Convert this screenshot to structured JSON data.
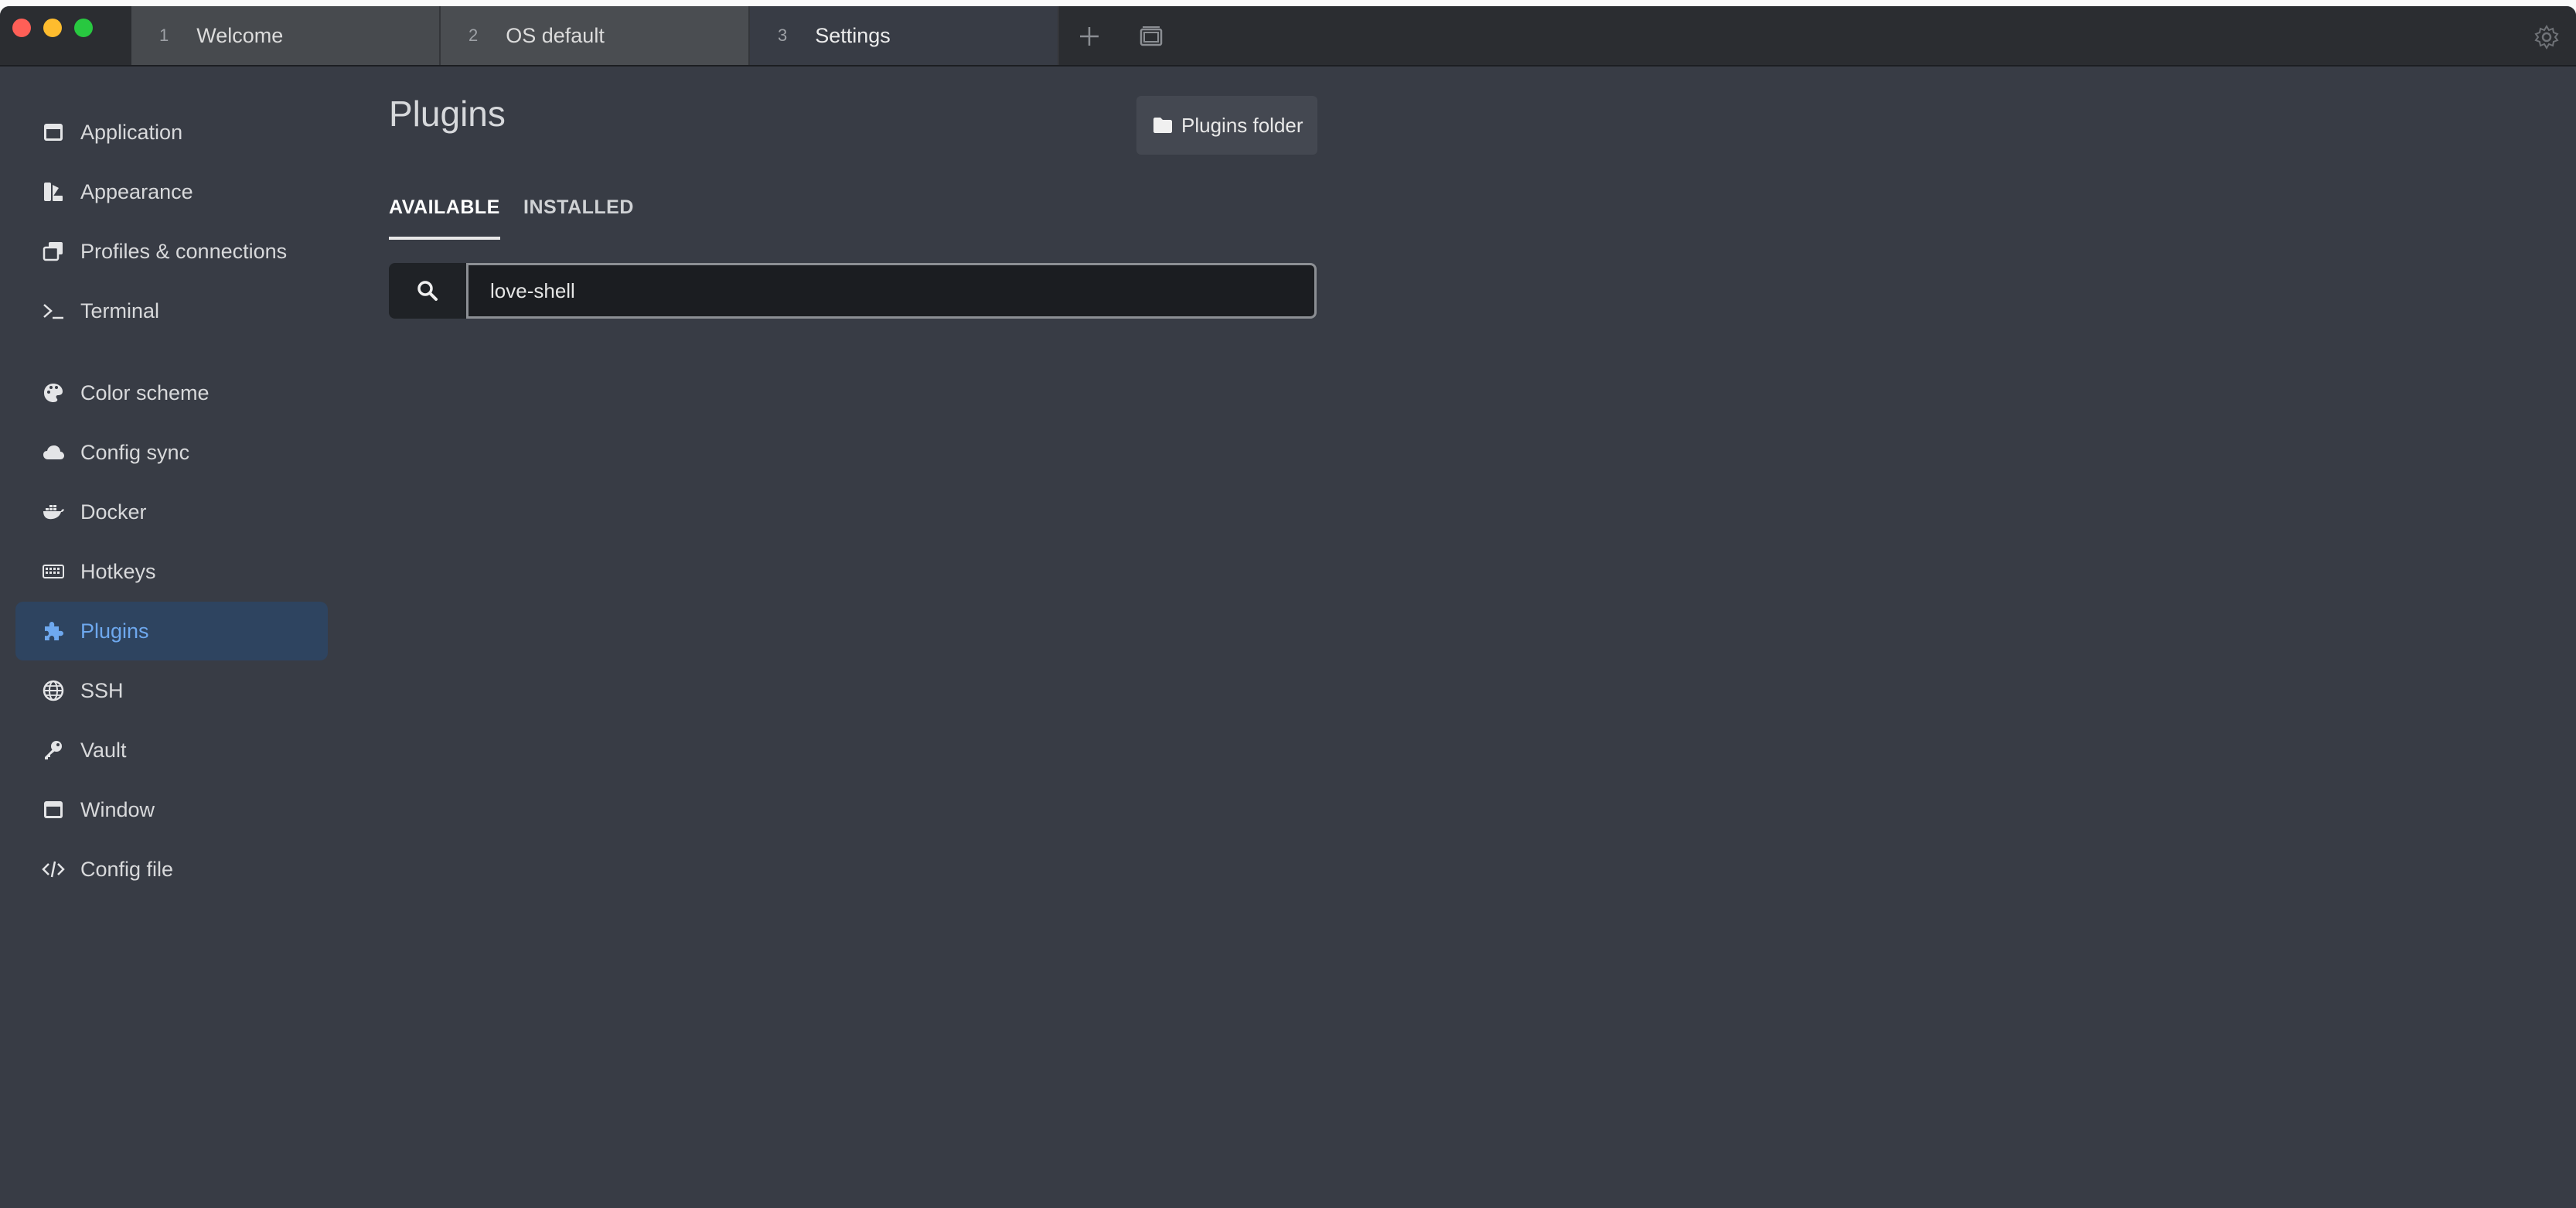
{
  "tabs": [
    {
      "number": "1",
      "label": "Welcome"
    },
    {
      "number": "2",
      "label": "OS default"
    },
    {
      "number": "3",
      "label": "Settings"
    }
  ],
  "sidebar": {
    "items": [
      {
        "label": "Application",
        "icon": "window-icon"
      },
      {
        "label": "Appearance",
        "icon": "palette-brush-icon"
      },
      {
        "label": "Profiles & connections",
        "icon": "windows-stack-icon"
      },
      {
        "label": "Terminal",
        "icon": "terminal-prompt-icon"
      },
      {
        "label": "Color scheme",
        "icon": "palette-icon"
      },
      {
        "label": "Config sync",
        "icon": "cloud-icon"
      },
      {
        "label": "Docker",
        "icon": "docker-icon"
      },
      {
        "label": "Hotkeys",
        "icon": "keyboard-icon"
      },
      {
        "label": "Plugins",
        "icon": "puzzle-icon",
        "active": true
      },
      {
        "label": "SSH",
        "icon": "globe-icon"
      },
      {
        "label": "Vault",
        "icon": "key-icon"
      },
      {
        "label": "Window",
        "icon": "window-icon"
      },
      {
        "label": "Config file",
        "icon": "code-icon"
      }
    ]
  },
  "main": {
    "title": "Plugins",
    "folder_button": "Plugins folder",
    "subtabs": [
      "AVAILABLE",
      "INSTALLED"
    ],
    "active_subtab": "AVAILABLE",
    "search": {
      "value": "love-shell",
      "placeholder": ""
    }
  },
  "colors": {
    "accent": "#6ea8ee",
    "active_bg": "#2e4460",
    "background": "#383c45"
  }
}
